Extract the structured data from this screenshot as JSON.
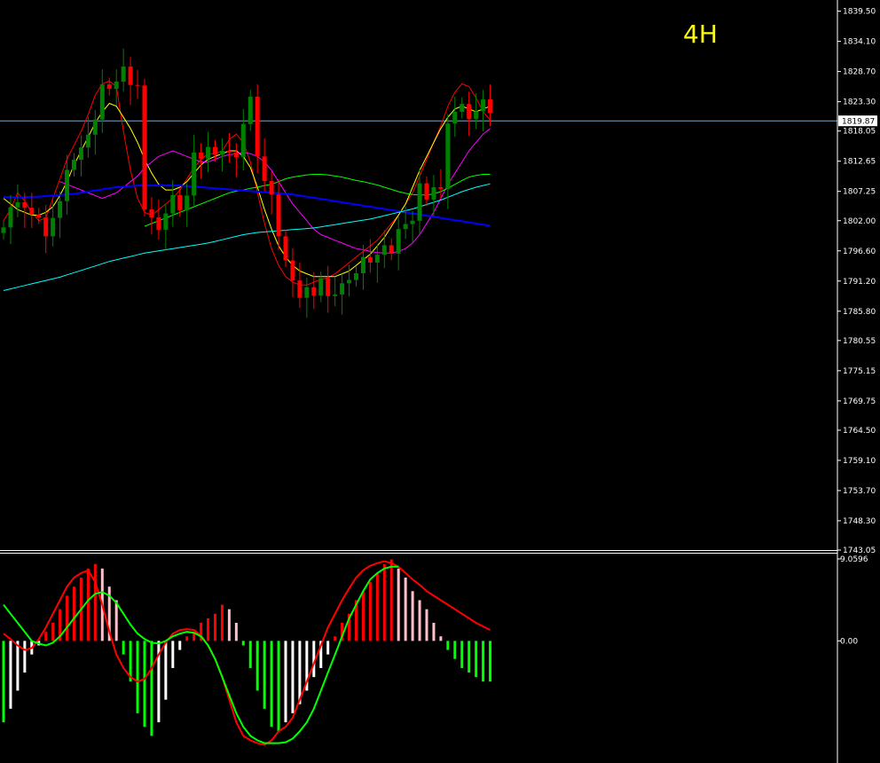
{
  "timeframe_label": "4H",
  "current_price_label": "1819.87",
  "colors": {
    "background": "#000000",
    "bull_candle": "#008000",
    "bear_candle": "#ff0000",
    "ma_fast": "#ff0000",
    "ma_yellow": "#ffff00",
    "ma_magenta": "#ff00ff",
    "ma_green": "#00ff00",
    "ma_blue": "#0000ff",
    "ma_cyan": "#00ffff",
    "macd_line": "#ff0000",
    "signal_line": "#00ff00",
    "hist_pos_rising": "#ff0000",
    "hist_pos_falling": "#ffc0cb",
    "hist_neg_falling": "#00ff00",
    "hist_neg_rising": "#ffffff",
    "axis_text": "#ffffff",
    "price_line": "#7fa6c9"
  },
  "chart_data": [
    {
      "type": "candlestick",
      "title": "4H",
      "y_ticks": [
        "1839.50",
        "1834.10",
        "1828.70",
        "1823.30",
        "1818.05",
        "1812.65",
        "1807.25",
        "1802.00",
        "1796.60",
        "1791.20",
        "1785.80",
        "1780.55",
        "1775.15",
        "1769.75",
        "1764.50",
        "1759.10",
        "1753.70",
        "1748.30",
        "1743.05"
      ],
      "ylim": [
        1743.05,
        1841.5
      ],
      "current_price": 1819.87,
      "x_count": 70,
      "closes": [
        1800.8,
        1804.4,
        1805.3,
        1804.3,
        1803.1,
        1802.6,
        1799.2,
        1802.5,
        1805.5,
        1811.1,
        1812.9,
        1815.1,
        1817.4,
        1820.1,
        1826.4,
        1825.6,
        1826.9,
        1829.6,
        1826.3,
        1826.2,
        1804.0,
        1802.6,
        1800.4,
        1803.3,
        1806.6,
        1803.9,
        1806.5,
        1814.2,
        1813.1,
        1815.2,
        1813.8,
        1814.5,
        1814.2,
        1813.4,
        1819.3,
        1824.2,
        1813.5,
        1809.1,
        1806.7,
        1799.2,
        1794.9,
        1791.3,
        1788.2,
        1790.1,
        1788.6,
        1791.7,
        1788.5,
        1788.8,
        1790.8,
        1791.4,
        1792.6,
        1795.5,
        1794.5,
        1795.9,
        1797.6,
        1796.1,
        1800.5,
        1801.4,
        1802.0,
        1808.7,
        1805.8,
        1808.0,
        1807.7,
        1819.4,
        1821.5,
        1822.9,
        1820.2,
        1821.6,
        1823.7,
        1821.3
      ],
      "series": [
        {
          "name": "",
          "color": "#ff0000",
          "values": [
            1802.0,
            1804.0,
            1807.0,
            1805.5,
            1803.5,
            1802.0,
            1802.5,
            1806.0,
            1809.5,
            1813.0,
            1815.5,
            1818.0,
            1821.0,
            1824.5,
            1826.5,
            1827.0,
            1826.0,
            1818.0,
            1811.0,
            1806.0,
            1803.5,
            1803.0,
            1804.0,
            1805.0,
            1806.0,
            1807.5,
            1809.5,
            1811.5,
            1813.0,
            1814.0,
            1814.0,
            1814.5,
            1816.5,
            1817.5,
            1816.0,
            1812.5,
            1807.0,
            1801.5,
            1797.0,
            1794.0,
            1792.0,
            1791.0,
            1790.5,
            1790.5,
            1791.0,
            1791.5,
            1791.8,
            1792.5,
            1793.5,
            1794.5,
            1795.5,
            1796.5,
            1797.5,
            1798.5,
            1800.0,
            1801.5,
            1803.0,
            1805.0,
            1807.0,
            1810.0,
            1813.0,
            1816.0,
            1819.0,
            1822.5,
            1825.0,
            1826.5,
            1826.0,
            1824.0,
            1821.5,
            1820.0
          ]
        },
        {
          "name": "",
          "color": "#ffff00",
          "values": [
            1806.0,
            1805.0,
            1804.0,
            1803.5,
            1803.0,
            1803.0,
            1803.5,
            1804.5,
            1806.5,
            1809.0,
            1812.0,
            1814.5,
            1817.0,
            1819.5,
            1821.5,
            1823.0,
            1822.5,
            1820.5,
            1818.5,
            1816.0,
            1813.0,
            1810.5,
            1808.5,
            1807.5,
            1807.5,
            1808.0,
            1809.0,
            1810.5,
            1812.0,
            1813.0,
            1813.5,
            1814.0,
            1814.5,
            1814.5,
            1813.5,
            1811.5,
            1808.0,
            1804.0,
            1800.5,
            1797.5,
            1795.5,
            1794.0,
            1793.0,
            1792.5,
            1792.0,
            1792.0,
            1792.0,
            1792.0,
            1792.5,
            1793.0,
            1794.0,
            1795.0,
            1796.0,
            1797.5,
            1799.0,
            1801.0,
            1803.0,
            1805.0,
            1808.0,
            1811.0,
            1813.5,
            1816.0,
            1818.5,
            1820.5,
            1822.0,
            1822.5,
            1822.0,
            1821.5,
            1822.0,
            1822.5
          ]
        },
        {
          "name": "",
          "color": "#ff00ff",
          "values": [
            1809.0,
            1808.5,
            1808.0,
            1807.5,
            1807.0,
            1806.5,
            1806.0,
            1806.5,
            1807.0,
            1808.0,
            1809.0,
            1810.0,
            1811.5,
            1812.5,
            1813.5,
            1814.0,
            1814.5,
            1814.0,
            1813.5,
            1813.0,
            1812.5,
            1812.5,
            1813.0,
            1813.5,
            1813.8,
            1814.0,
            1814.2,
            1814.0,
            1813.5,
            1812.5,
            1811.0,
            1809.0,
            1807.0,
            1805.0,
            1803.5,
            1802.0,
            1800.5,
            1799.5,
            1799.0,
            1798.5,
            1798.0,
            1797.5,
            1797.0,
            1796.8,
            1796.5,
            1796.3,
            1796.2,
            1796.2,
            1796.5,
            1797.0,
            1798.0,
            1799.5,
            1801.5,
            1803.5,
            1806.0,
            1808.5,
            1810.5,
            1812.5,
            1814.5,
            1816.0,
            1817.5,
            1818.5
          ],
          "start": 8
        },
        {
          "name": "",
          "color": "#00ff00",
          "values": [
            1801.0,
            1801.5,
            1802.0,
            1802.5,
            1803.0,
            1803.5,
            1804.0,
            1804.5,
            1805.0,
            1805.5,
            1806.0,
            1806.5,
            1807.0,
            1807.3,
            1807.5,
            1807.8,
            1808.0,
            1808.3,
            1808.5,
            1809.0,
            1809.5,
            1809.8,
            1810.0,
            1810.2,
            1810.3,
            1810.3,
            1810.2,
            1810.0,
            1809.8,
            1809.5,
            1809.2,
            1809.0,
            1808.7,
            1808.4,
            1808.0,
            1807.6,
            1807.2,
            1806.9,
            1806.7,
            1806.6,
            1806.6,
            1806.8,
            1807.2,
            1807.8,
            1808.5,
            1809.2,
            1809.8,
            1810.1,
            1810.3,
            1810.3
          ],
          "start": 20
        },
        {
          "name": "",
          "color": "#0000ff",
          "values": [
            1806.3,
            1806.2,
            1806.2,
            1806.2,
            1806.3,
            1806.3,
            1806.4,
            1806.5,
            1806.6,
            1806.7,
            1806.8,
            1807.0,
            1807.2,
            1807.4,
            1807.6,
            1807.8,
            1808.0,
            1808.1,
            1808.2,
            1808.3,
            1808.3,
            1808.3,
            1808.3,
            1808.3,
            1808.3,
            1808.3,
            1808.2,
            1808.1,
            1808.0,
            1807.9,
            1807.8,
            1807.7,
            1807.6,
            1807.5,
            1807.4,
            1807.3,
            1807.2,
            1807.1,
            1807.0,
            1806.9,
            1806.8,
            1806.7,
            1806.5,
            1806.3,
            1806.1,
            1805.9,
            1805.7,
            1805.5,
            1805.3,
            1805.1,
            1804.9,
            1804.7,
            1804.5,
            1804.3,
            1804.1,
            1803.9,
            1803.7,
            1803.5,
            1803.3,
            1803.1,
            1802.9,
            1802.7,
            1802.5,
            1802.3,
            1802.1,
            1801.9,
            1801.7,
            1801.5,
            1801.3,
            1801.1
          ]
        },
        {
          "name": "",
          "color": "#00ffff",
          "values": [
            1789.5,
            1789.8,
            1790.1,
            1790.4,
            1790.7,
            1791.0,
            1791.3,
            1791.6,
            1791.9,
            1792.3,
            1792.7,
            1793.1,
            1793.5,
            1793.9,
            1794.3,
            1794.7,
            1795.0,
            1795.3,
            1795.6,
            1795.9,
            1796.2,
            1796.4,
            1796.6,
            1796.8,
            1797.0,
            1797.2,
            1797.4,
            1797.6,
            1797.8,
            1798.0,
            1798.3,
            1798.6,
            1798.9,
            1799.2,
            1799.5,
            1799.7,
            1799.9,
            1800.0,
            1800.1,
            1800.2,
            1800.3,
            1800.4,
            1800.5,
            1800.6,
            1800.7,
            1800.9,
            1801.1,
            1801.3,
            1801.5,
            1801.7,
            1801.9,
            1802.1,
            1802.3,
            1802.6,
            1802.9,
            1803.2,
            1803.5,
            1803.8,
            1804.1,
            1804.5,
            1804.9,
            1805.3,
            1805.7,
            1806.2,
            1806.7,
            1807.2,
            1807.6,
            1808.0,
            1808.3,
            1808.6
          ]
        }
      ]
    },
    {
      "type": "bar",
      "title": "",
      "y_ticks": [
        "9.0596",
        "0.00"
      ],
      "ylim": [
        -13.5,
        9.0596
      ],
      "histogram": [
        -9.0,
        -7.5,
        -5.5,
        -3.5,
        -1.5,
        -0.5,
        1.0,
        2.0,
        3.5,
        5.0,
        6.0,
        7.0,
        8.0,
        8.5,
        8.0,
        6.0,
        4.5,
        -1.5,
        -4.5,
        -8.0,
        -9.5,
        -10.5,
        -9.0,
        -6.5,
        -3.0,
        -1.0,
        0.5,
        1.0,
        2.0,
        2.5,
        3.0,
        4.0,
        3.5,
        2.0,
        -0.5,
        -3.0,
        -5.5,
        -7.5,
        -9.5,
        -10.0,
        -9.0,
        -8.0,
        -7.0,
        -5.5,
        -4.0,
        -3.0,
        -1.5,
        0.5,
        2.0,
        3.0,
        4.5,
        5.5,
        6.5,
        7.5,
        8.5,
        9.0,
        8.0,
        7.0,
        5.5,
        4.5,
        3.5,
        2.0,
        0.5,
        -1.0,
        -2.0,
        -3.0,
        -3.5,
        -4.0,
        -4.5,
        -4.5
      ],
      "series": [
        {
          "name": "",
          "color": "#ff0000",
          "values": [
            0.8,
            0.2,
            -0.5,
            -1.0,
            -0.8,
            0.2,
            1.5,
            3.0,
            4.5,
            6.0,
            7.0,
            7.5,
            7.8,
            6.5,
            4.0,
            1.0,
            -1.5,
            -3.0,
            -4.0,
            -4.5,
            -4.2,
            -3.0,
            -1.5,
            -0.2,
            0.8,
            1.2,
            1.3,
            1.2,
            0.6,
            -0.5,
            -2.0,
            -4.0,
            -6.5,
            -9.0,
            -10.5,
            -11.0,
            -11.3,
            -11.5,
            -11.0,
            -10.0,
            -9.5,
            -8.5,
            -6.5,
            -4.5,
            -2.5,
            -0.5,
            1.5,
            3.0,
            4.5,
            5.8,
            7.0,
            7.8,
            8.3,
            8.6,
            8.8,
            8.6,
            8.2,
            7.5,
            6.8,
            6.2,
            5.5,
            5.0,
            4.5,
            4.0,
            3.5,
            3.0,
            2.5,
            2.0,
            1.6,
            1.2
          ]
        },
        {
          "name": "",
          "color": "#00ff00",
          "values": [
            4.0,
            3.0,
            2.0,
            1.0,
            0.0,
            -0.3,
            -0.5,
            -0.2,
            0.5,
            1.5,
            2.5,
            3.5,
            4.5,
            5.2,
            5.4,
            5.0,
            4.2,
            3.0,
            1.8,
            0.8,
            0.2,
            -0.2,
            -0.3,
            0.0,
            0.5,
            0.8,
            1.0,
            0.9,
            0.5,
            -0.5,
            -2.0,
            -4.0,
            -6.0,
            -8.0,
            -9.5,
            -10.5,
            -11.0,
            -11.3,
            -11.3,
            -11.3,
            -11.2,
            -10.8,
            -10.0,
            -9.0,
            -7.5,
            -5.5,
            -3.5,
            -1.5,
            0.5,
            2.5,
            4.0,
            5.5,
            6.8,
            7.5,
            8.0,
            8.2,
            8.2
          ]
        }
      ]
    }
  ]
}
